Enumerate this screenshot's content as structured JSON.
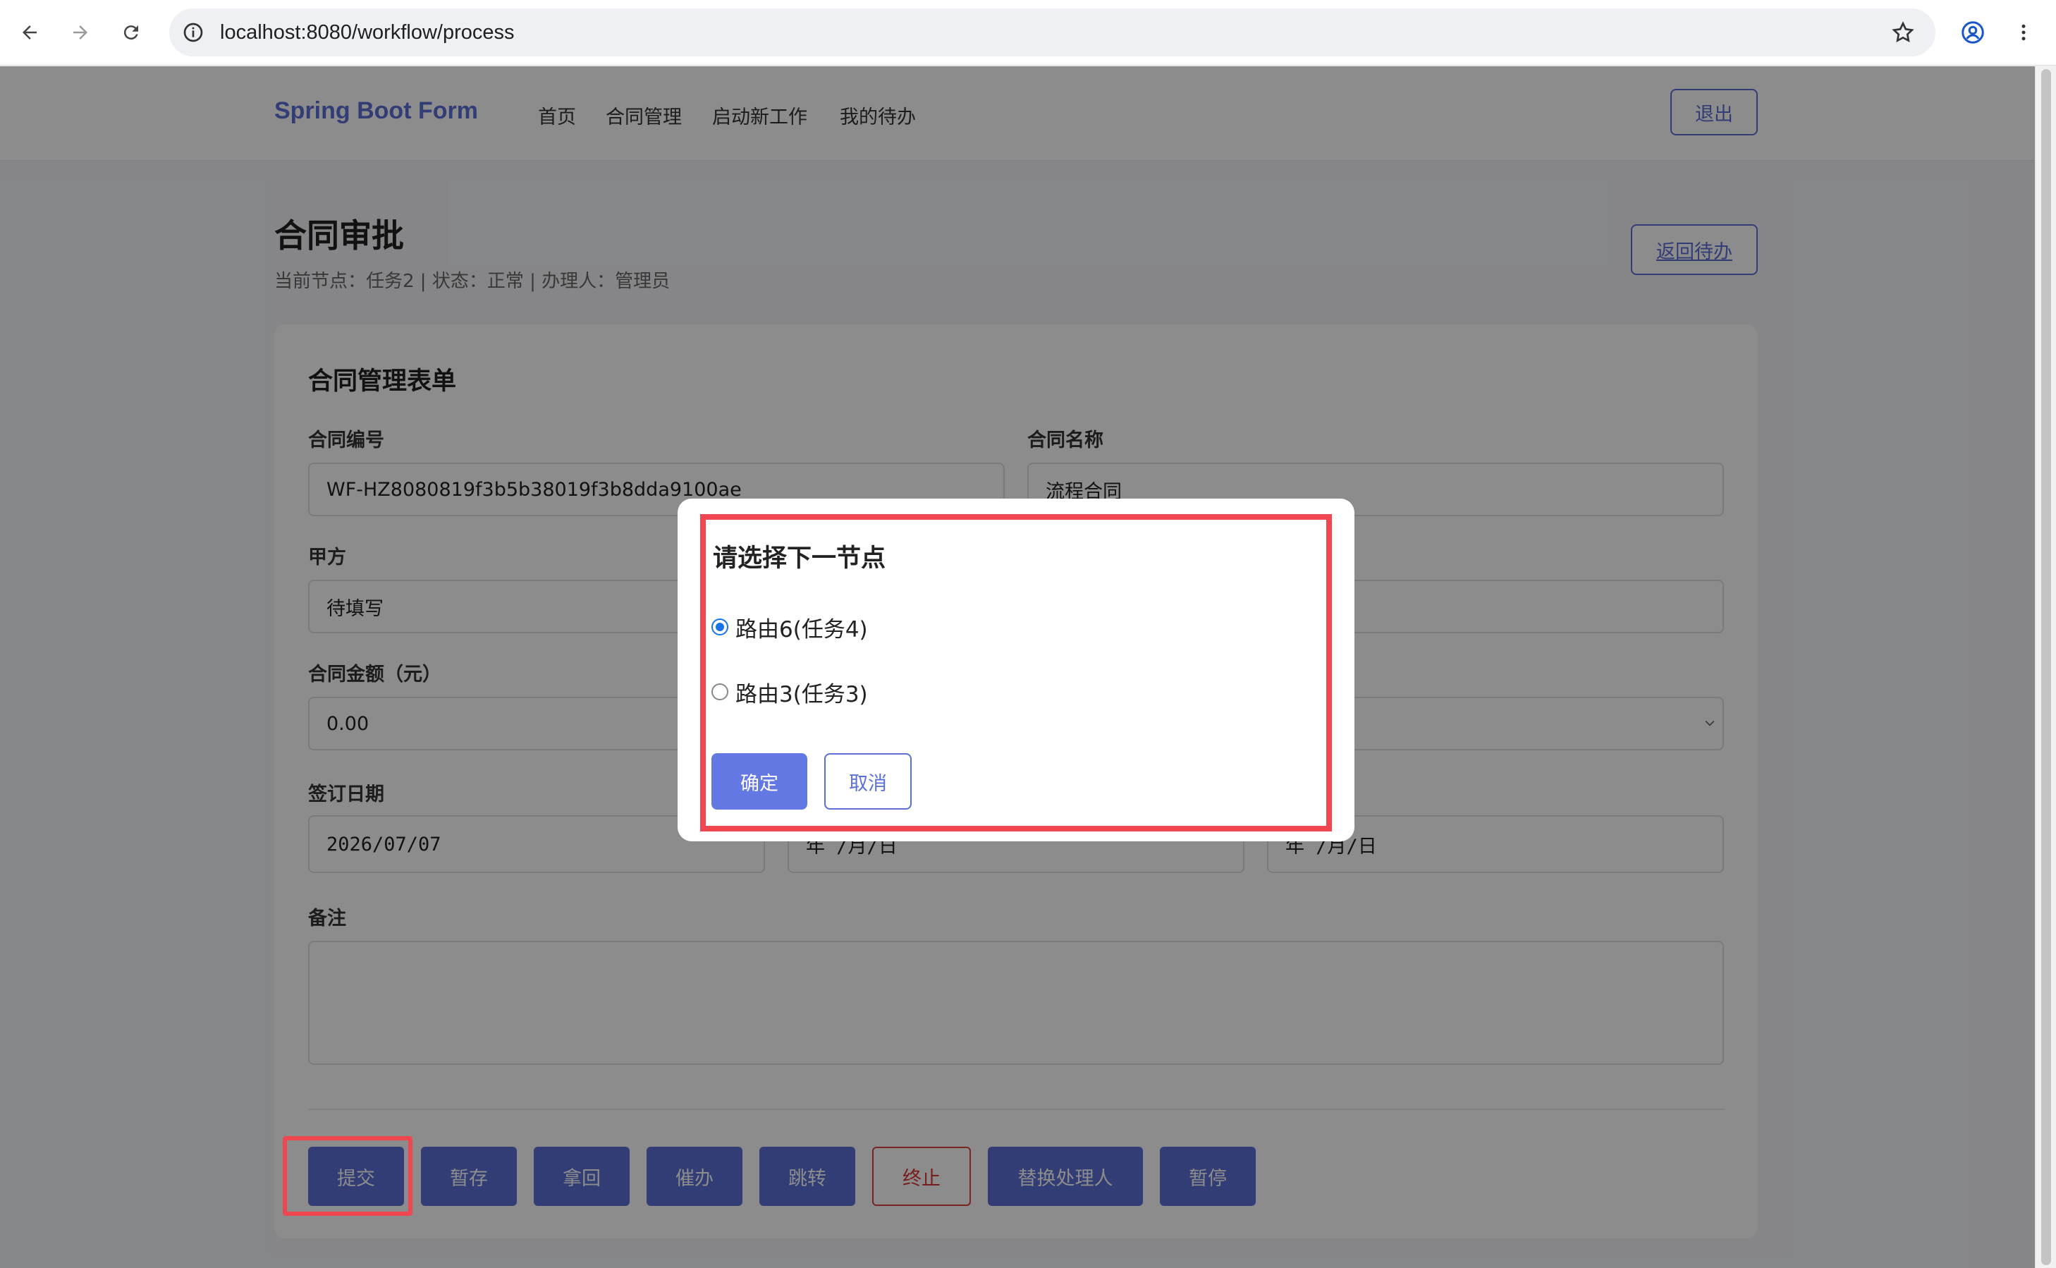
{
  "browser": {
    "url": "localhost:8080/workflow/process"
  },
  "topnav": {
    "brand": "Spring Boot Form",
    "menu": [
      "首页",
      "合同管理",
      "启动新工作",
      "我的待办"
    ],
    "logout": "退出"
  },
  "header": {
    "title": "合同审批",
    "subtitle": "当前节点：任务2 | 状态：正常 | 办理人：管理员",
    "back": "返回待办"
  },
  "form": {
    "title": "合同管理表单",
    "contract_no_label": "合同编号",
    "contract_no": "WF-HZ8080819f3b5b38019f3b8dda9100ae",
    "contract_name_label": "合同名称",
    "contract_name": "流程合同",
    "party_a_label": "甲方",
    "party_a": "待填写",
    "amount_label": "合同金额（元）",
    "amount": "0.00",
    "sign_date_label": "签订日期",
    "sign_date": "2026/07/07",
    "date_placeholder_2": "年 /月/日",
    "date_placeholder_3": "年 /月/日",
    "remark_label": "备注"
  },
  "actions": [
    "提交",
    "暂存",
    "拿回",
    "催办",
    "跳转",
    "终止",
    "替换处理人",
    "暂停"
  ],
  "modal": {
    "title": "请选择下一节点",
    "options": [
      {
        "label": "路由6(任务4)",
        "checked": true
      },
      {
        "label": "路由3(任务3)",
        "checked": false
      }
    ],
    "confirm": "确定",
    "cancel": "取消"
  },
  "colors": {
    "accent": "#5b6fd8",
    "highlight": "#ef4650"
  }
}
